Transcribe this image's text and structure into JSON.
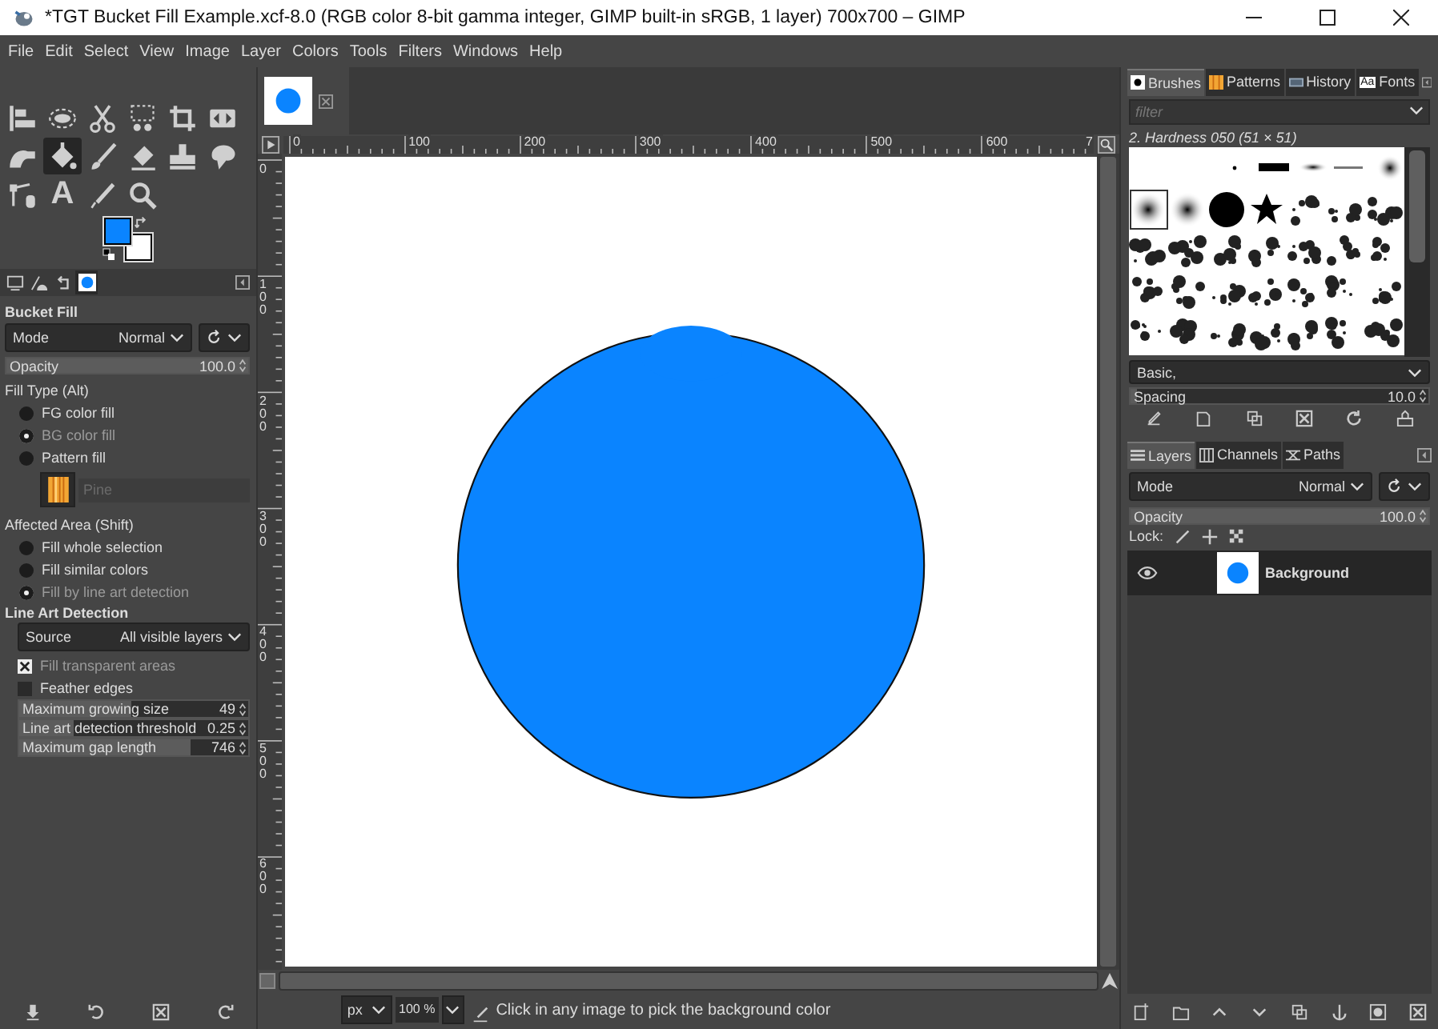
{
  "window": {
    "title": "*TGT Bucket Fill Example.xcf-8.0 (RGB color 8-bit gamma integer, GIMP built-in sRGB, 1 layer) 700x700 – GIMP"
  },
  "menu": [
    "File",
    "Edit",
    "Select",
    "View",
    "Image",
    "Layer",
    "Colors",
    "Tools",
    "Filters",
    "Windows",
    "Help"
  ],
  "toolbox": {
    "tools": [
      {
        "kind": "align",
        "selected": false
      },
      {
        "kind": "ellipse-select",
        "selected": false
      },
      {
        "kind": "scissors",
        "selected": false
      },
      {
        "kind": "fuzzy-select",
        "selected": false
      },
      {
        "kind": "crop",
        "selected": false
      },
      {
        "kind": "flip",
        "selected": false
      },
      {
        "kind": "smudge",
        "selected": false
      },
      {
        "kind": "bucket",
        "selected": true
      },
      {
        "kind": "brush",
        "selected": false
      },
      {
        "kind": "eraser",
        "selected": false
      },
      {
        "kind": "clone",
        "selected": false
      },
      {
        "kind": "warp",
        "selected": false
      },
      {
        "kind": "paths",
        "selected": false
      },
      {
        "kind": "text",
        "glyph": "A",
        "selected": false
      },
      {
        "kind": "picker",
        "selected": false
      },
      {
        "kind": "zoom",
        "selected": false
      }
    ],
    "swatches": [
      {
        "kind": "foreground",
        "color": "#0a84ff"
      },
      {
        "kind": "background",
        "color": "#ffffff"
      }
    ]
  },
  "left_dock_tabs": [
    {
      "selected": false
    },
    {
      "selected": false
    },
    {
      "selected": false
    },
    {
      "selected": true
    }
  ],
  "tool_options": {
    "title": "Bucket Fill",
    "mode": {
      "label": "Mode",
      "value": "Normal"
    },
    "opacity": {
      "label": "Opacity",
      "value": "100.0",
      "level": 1
    },
    "fill_type": {
      "heading": "Fill Type  (Alt)",
      "options": [
        {
          "label": "FG color fill",
          "selected": false
        },
        {
          "label": "BG color fill",
          "selected": true
        },
        {
          "label": "Pattern fill",
          "selected": false
        }
      ]
    },
    "pattern": {
      "name": "Pine"
    },
    "affected_area": {
      "heading": "Affected Area  (Shift)",
      "options": [
        {
          "label": "Fill whole selection",
          "selected": false
        },
        {
          "label": "Fill similar colors",
          "selected": false
        },
        {
          "label": "Fill by line art detection",
          "selected": true
        }
      ]
    },
    "line_art": {
      "heading": "Line Art Detection",
      "source": {
        "label": "Source",
        "value": "All visible layers"
      },
      "checkboxes": [
        {
          "label": "Fill transparent areas",
          "checked": true
        },
        {
          "label": "Feather edges",
          "checked": false
        }
      ],
      "spinners": [
        {
          "label": "Maximum growing size",
          "value": "49",
          "level": 0.49
        },
        {
          "label": "Line art detection threshold",
          "value": "0.25",
          "level": 0.24
        },
        {
          "label": "Maximum gap length",
          "value": "746",
          "level": 0.75
        }
      ]
    }
  },
  "rulers": {
    "horizontal": [
      "0",
      "100",
      "200",
      "300",
      "400",
      "500",
      "600",
      "7"
    ],
    "vertical": [
      "0",
      "100",
      "200",
      "300",
      "400",
      "500",
      "600"
    ]
  },
  "status_bar": {
    "unit": "px",
    "zoom": "100 %",
    "message": "Click in any image to pick the background color"
  },
  "right_dock": {
    "tabs": [
      {
        "label": "Brushes",
        "selected": true
      },
      {
        "label": "Patterns",
        "selected": false
      },
      {
        "label": "History",
        "selected": false
      },
      {
        "label": "Fonts",
        "icon_text": "Aa",
        "selected": false
      }
    ],
    "filter_placeholder": "filter",
    "brush_name": "2. Hardness 050 (51 × 51)",
    "tag": "Basic,",
    "spacing": {
      "label": "Spacing",
      "value": "10.0",
      "level": 0.02
    }
  },
  "layers_dock": {
    "tabs": [
      {
        "label": "Layers",
        "selected": true
      },
      {
        "label": "Channels",
        "selected": false
      },
      {
        "label": "Paths",
        "selected": false
      }
    ],
    "mode": {
      "label": "Mode",
      "value": "Normal"
    },
    "opacity": {
      "label": "Opacity",
      "value": "100.0",
      "level": 1
    },
    "lock_label": "Lock:",
    "layers": [
      {
        "name": "Background",
        "visible": true,
        "selected": true
      }
    ]
  }
}
